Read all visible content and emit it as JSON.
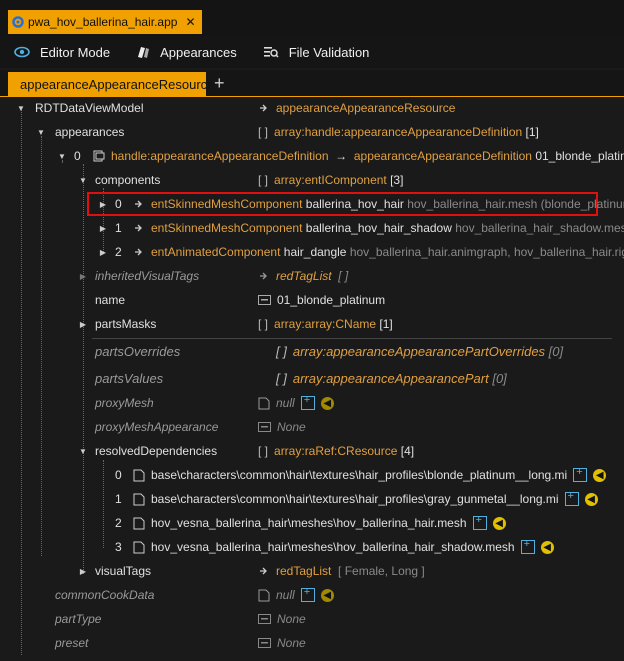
{
  "file_tab": {
    "label": "pwa_hov_ballerina_hair.app",
    "close": "✕"
  },
  "toolbar": {
    "editor_mode": "Editor Mode",
    "appearances": "Appearances",
    "file_validation": "File Validation"
  },
  "doc_tab": {
    "label": "appearanceAppearanceResource",
    "add": "+"
  },
  "tree": {
    "root": {
      "label": "RDTDataViewModel",
      "value": "appearanceAppearanceResource"
    },
    "appearances": {
      "label": "appearances",
      "bracket": "[ ]",
      "type": "array:handle:appearanceAppearanceDefinition",
      "count": "[1]"
    },
    "app0": {
      "index": "0",
      "handle": "handle:appearanceAppearanceDefinition",
      "arrow": "→",
      "type": "appearanceAppearanceDefinition",
      "name": "01_blonde_platinum"
    },
    "components": {
      "label": "components",
      "bracket": "[ ]",
      "type": "array:entIComponent",
      "count": "[3]"
    },
    "comp0": {
      "index": "0",
      "type": "entSkinnedMeshComponent",
      "name": "ballerina_hov_hair",
      "detail": "hov_ballerina_hair.mesh (blonde_platinum)"
    },
    "comp1": {
      "index": "1",
      "type": "entSkinnedMeshComponent",
      "name": "ballerina_hov_hair_shadow",
      "detail": "hov_ballerina_hair_shadow.mesh"
    },
    "comp2": {
      "index": "2",
      "type": "entAnimatedComponent",
      "name": "hair_dangle",
      "detail": "hov_ballerina_hair.animgraph, hov_ballerina_hair.rig"
    },
    "inheritedVisualTags": {
      "label": "inheritedVisualTags",
      "type": "redTagList",
      "value": "[ ]"
    },
    "name": {
      "label": "name",
      "value": "01_blonde_platinum"
    },
    "partsMasks": {
      "label": "partsMasks",
      "bracket": "[ ]",
      "type": "array:array:CName",
      "count": "[1]"
    },
    "partsOverrides": {
      "label": "partsOverrides",
      "bracket": "[ ]",
      "type": "array:appearanceAppearancePartOverrides",
      "count": "[0]"
    },
    "partsValues": {
      "label": "partsValues",
      "bracket": "[ ]",
      "type": "array:appearanceAppearancePart",
      "count": "[0]"
    },
    "proxyMesh": {
      "label": "proxyMesh",
      "value": "null"
    },
    "proxyMeshAppearance": {
      "label": "proxyMeshAppearance",
      "value": "None"
    },
    "resolvedDependencies": {
      "label": "resolvedDependencies",
      "bracket": "[ ]",
      "type": "array:raRef:CResource",
      "count": "[4]"
    },
    "dep0": {
      "index": "0",
      "path": "base\\characters\\common\\hair\\textures\\hair_profiles\\blonde_platinum__long.mi"
    },
    "dep1": {
      "index": "1",
      "path": "base\\characters\\common\\hair\\textures\\hair_profiles\\gray_gunmetal__long.mi"
    },
    "dep2": {
      "index": "2",
      "path": "hov_vesna_ballerina_hair\\meshes\\hov_ballerina_hair.mesh"
    },
    "dep3": {
      "index": "3",
      "path": "hov_vesna_ballerina_hair\\meshes\\hov_ballerina_hair_shadow.mesh"
    },
    "visualTags": {
      "label": "visualTags",
      "type": "redTagList",
      "value": "[ Female, Long ]"
    },
    "commonCookData": {
      "label": "commonCookData",
      "value": "null"
    },
    "partType": {
      "label": "partType",
      "value": "None"
    },
    "preset": {
      "label": "preset",
      "value": "None"
    }
  },
  "colors": {
    "accent": "#f0a000",
    "highlight": "#e01010",
    "type_text": "#e0a040"
  }
}
